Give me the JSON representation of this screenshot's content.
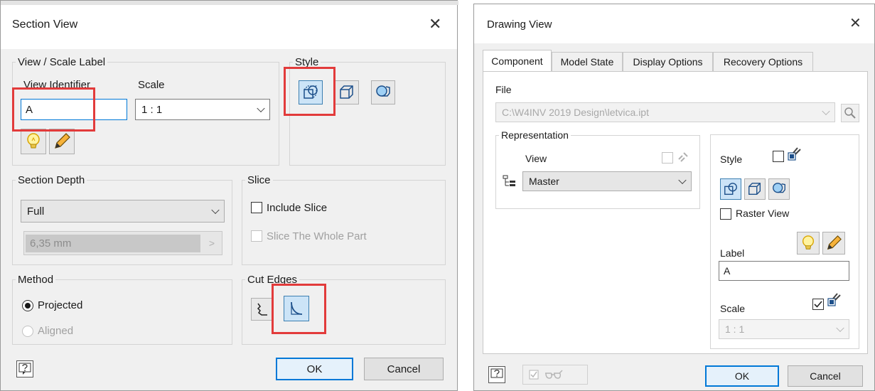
{
  "section_view": {
    "title": "Section View",
    "close_glyph": "✕",
    "view_scale_label": {
      "legend": "View / Scale Label",
      "view_identifier_label": "View Identifier",
      "view_identifier_value": "A",
      "scale_label": "Scale",
      "scale_value": "1 : 1",
      "icons": [
        "lightbulb-icon",
        "pencil-icon"
      ]
    },
    "style": {
      "legend": "Style",
      "icons": [
        "hidden-lines-icon",
        "hidden-lines-removed-icon",
        "shaded-icon"
      ],
      "selected_index": 0
    },
    "section_depth": {
      "legend": "Section Depth",
      "value": "Full",
      "distance": "6,35 mm"
    },
    "slice": {
      "legend": "Slice",
      "include_slice": "Include Slice",
      "include_slice_checked": false,
      "slice_whole_part": "Slice The Whole Part",
      "slice_whole_part_checked": false
    },
    "method": {
      "legend": "Method",
      "projected": "Projected",
      "aligned": "Aligned",
      "selected": "projected"
    },
    "cut_edges": {
      "legend": "Cut Edges",
      "icons": [
        "cut-edges-jagged-icon",
        "cut-edges-smooth-icon"
      ],
      "selected_index": 1
    },
    "ok": "OK",
    "cancel": "Cancel",
    "highlight_color": "#e23b3b"
  },
  "drawing_view": {
    "title": "Drawing View",
    "close_glyph": "✕",
    "tabs": [
      "Component",
      "Model State",
      "Display Options",
      "Recovery Options"
    ],
    "active_tab": 0,
    "file_label": "File",
    "file_value": "C:\\W4INV 2019 Design\\letvica.ipt",
    "representation": {
      "legend": "Representation",
      "view_label": "View",
      "view_value": "Master"
    },
    "style_label": "Style",
    "raster_view": "Raster View",
    "raster_view_checked": false,
    "label_label": "Label",
    "label_value": "A",
    "scale_label": "Scale",
    "scale_value": "1 : 1",
    "scale_checked": true,
    "ok": "OK",
    "cancel": "Cancel"
  }
}
